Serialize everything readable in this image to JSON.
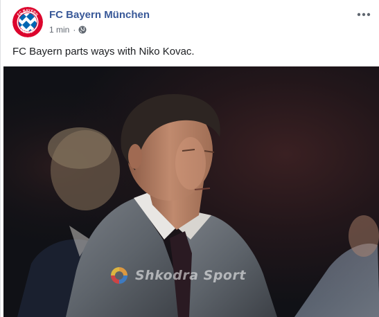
{
  "post": {
    "page_name": "FC Bayern München",
    "timestamp": "1 min",
    "separator": "·",
    "privacy_icon": "globe-icon",
    "more_icon": "more-options-icon",
    "text": "FC Bayern parts ways with Niko Kovac."
  },
  "logo": {
    "top_text": "FC BAYERN",
    "bottom_text": "MÜNCHEN",
    "colors": {
      "red": "#dc052d",
      "blue": "#0066b2",
      "white": "#ffffff"
    }
  },
  "photo": {
    "watermark_text": "Shkodra Sport"
  },
  "colors": {
    "link_blue": "#385898",
    "meta_gray": "#606770",
    "text_dark": "#1c1e21"
  }
}
